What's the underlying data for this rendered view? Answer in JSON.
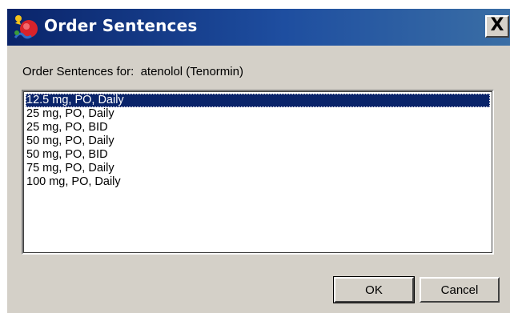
{
  "window": {
    "title": "Order Sentences",
    "close_label": "X"
  },
  "dialog": {
    "label_prefix": "Order Sentences for:",
    "drug_name": "atenolol (Tenormin)"
  },
  "list": {
    "selected_index": 0,
    "items": [
      "12.5 mg, PO, Daily",
      "25 mg, PO, Daily",
      "25 mg, PO, BID",
      "50 mg, PO, Daily",
      "50 mg, PO, BID",
      "75 mg, PO, Daily",
      "100 mg, PO, Daily"
    ]
  },
  "buttons": {
    "ok_label": "OK",
    "cancel_label": "Cancel"
  },
  "icons": {
    "app": "order-sentences-app-icon",
    "close": "close-icon"
  },
  "colors": {
    "titlebar": "#0a246a",
    "selection": "#0a246a",
    "face": "#d4d0c8"
  }
}
